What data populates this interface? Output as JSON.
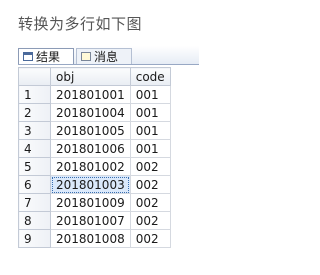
{
  "heading": "转换为多行如下图",
  "tabs": [
    {
      "label": "结果",
      "icon": "results-grid-icon"
    },
    {
      "label": "消息",
      "icon": "messages-icon"
    }
  ],
  "table": {
    "columns": [
      "obj",
      "code"
    ],
    "rows": [
      {
        "num": "1",
        "obj": "201801001",
        "code": "001"
      },
      {
        "num": "2",
        "obj": "201801004",
        "code": "001"
      },
      {
        "num": "3",
        "obj": "201801005",
        "code": "001"
      },
      {
        "num": "4",
        "obj": "201801006",
        "code": "001"
      },
      {
        "num": "5",
        "obj": "201801002",
        "code": "002"
      },
      {
        "num": "6",
        "obj": "201801003",
        "code": "002"
      },
      {
        "num": "7",
        "obj": "201801009",
        "code": "002"
      },
      {
        "num": "8",
        "obj": "201801007",
        "code": "002"
      },
      {
        "num": "9",
        "obj": "201801008",
        "code": "002"
      }
    ],
    "selected_row": 5
  }
}
